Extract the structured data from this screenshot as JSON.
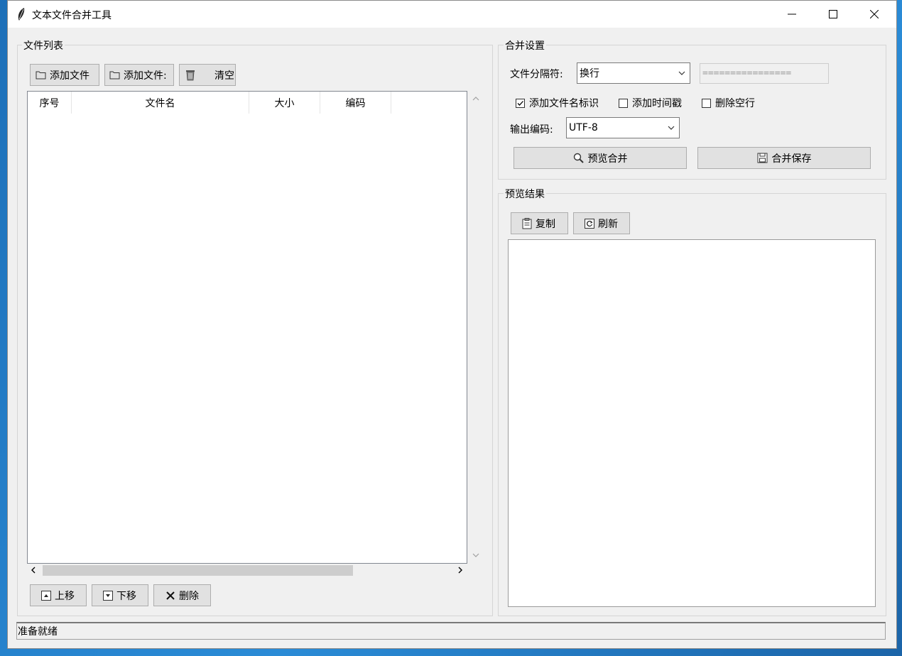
{
  "window": {
    "title": "文本文件合并工具",
    "minimize_icon": "minimize-icon",
    "maximize_icon": "maximize-icon",
    "close_icon": "close-icon"
  },
  "file_list": {
    "legend": "文件列表",
    "toolbar": {
      "add_file": "添加文件",
      "add_folder": "添加文件:",
      "clear": "清空"
    },
    "columns": [
      "序号",
      "文件名",
      "大小",
      "编码"
    ],
    "rows": [],
    "move_up": "上移",
    "move_down": "下移",
    "delete": "删除"
  },
  "merge_settings": {
    "legend": "合并设置",
    "separator_label": "文件分隔符:",
    "separator_value": "换行",
    "separator_custom": "================",
    "add_filename_marker": {
      "label": "添加文件名标识",
      "checked": true
    },
    "add_timestamp": {
      "label": "添加时间戳",
      "checked": false
    },
    "remove_empty_lines": {
      "label": "删除空行",
      "checked": false
    },
    "output_encoding_label": "输出编码:",
    "output_encoding_value": "UTF-8",
    "preview_merge": "预览合并",
    "merge_save": "合并保存"
  },
  "preview": {
    "legend": "预览结果",
    "copy": "复制",
    "refresh": "刷新",
    "content": ""
  },
  "status": {
    "text": "准备就绪"
  },
  "colors": {
    "window_bg": "#f0f0f0",
    "button_bg": "#e1e1e1",
    "button_border": "#adadad",
    "desktop": "#1d6fb8"
  }
}
